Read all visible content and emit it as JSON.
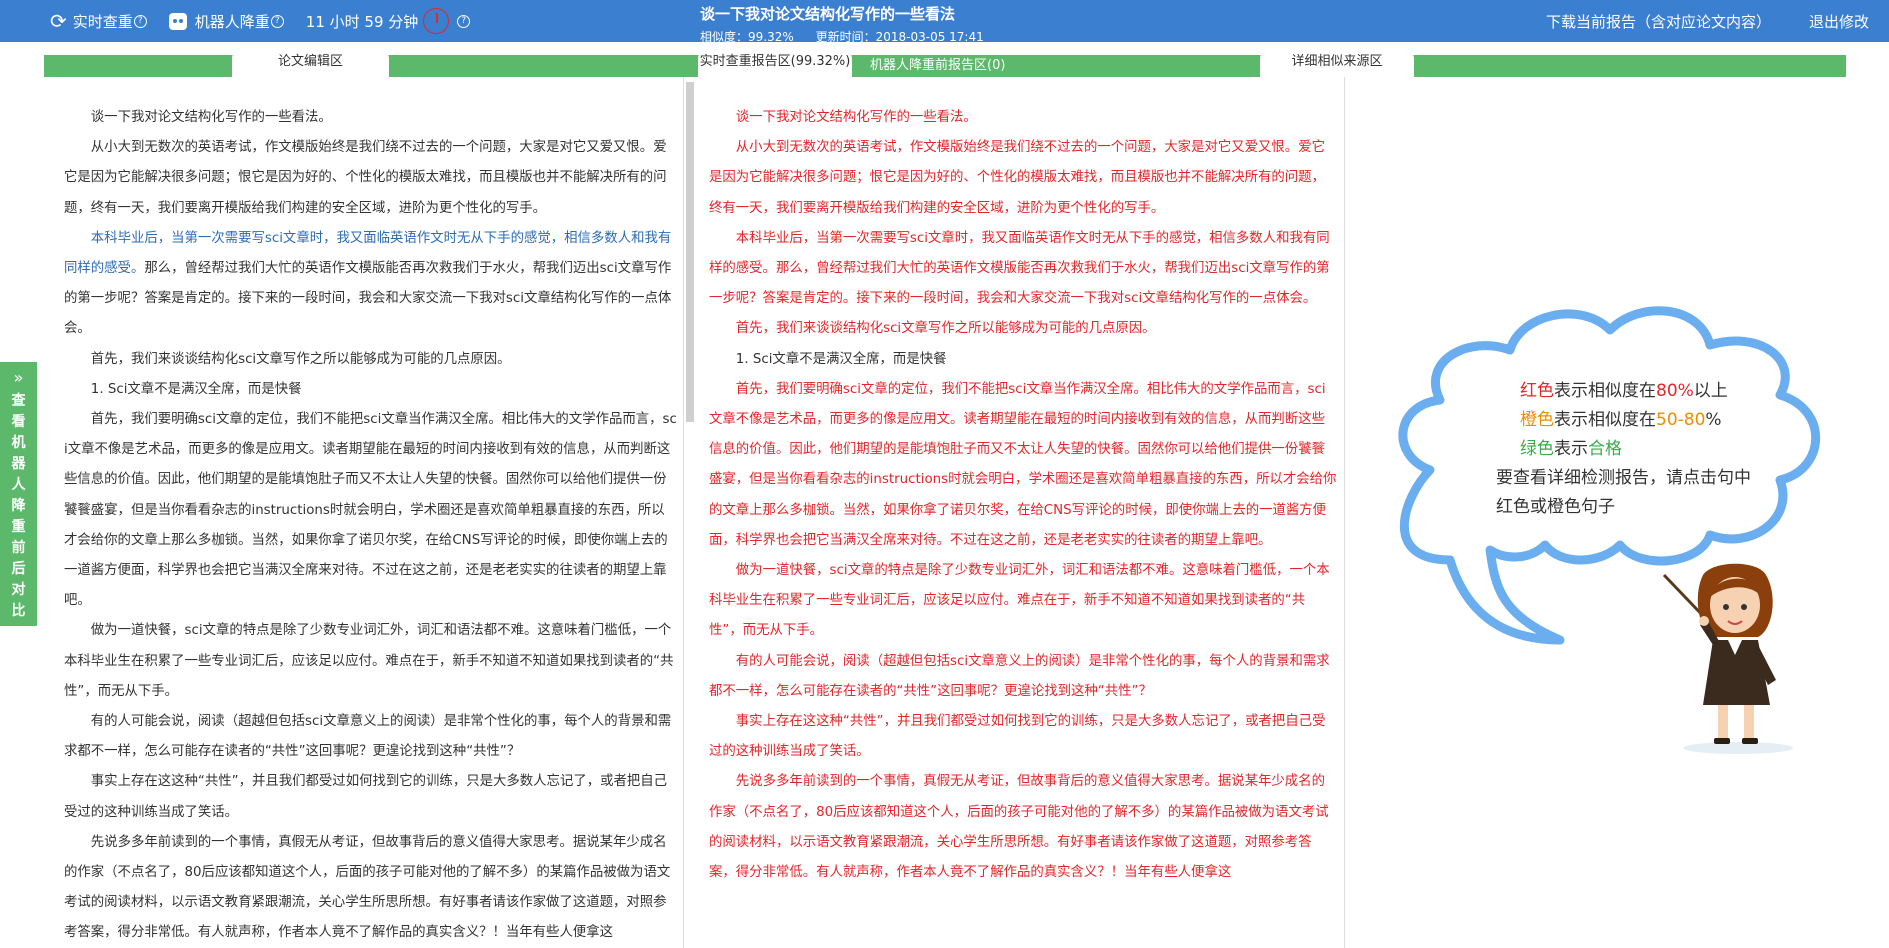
{
  "topbar": {
    "realtime_check": "实时查重",
    "robot_reduce": "机器人降重",
    "time_left": "11 小时 59 分钟",
    "help": "?",
    "title": "谈一下我对论文结构化写作的一些看法",
    "similarity": "相似度：99.32%",
    "updated": "更新时间：2018-03-05 17:41",
    "download": "下载当前报告（含对应论文内容）",
    "exit": "退出修改"
  },
  "tabs": {
    "editor": "论文编辑区",
    "report": "实时查重报告区(99.32%)",
    "robot_report": "机器人降重前报告区(0)",
    "sources": "详细相似来源区"
  },
  "sidetab": {
    "arrow": "»",
    "label": "查看机器人降重前后对比"
  },
  "paragraphs": [
    "谈一下我对论文结构化写作的一些看法。",
    "从小大到无数次的英语考试，作文模版始终是我们绕不过去的一个问题，大家是对它又爱又恨。爱它是因为它能解决很多问题；恨它是因为好的、个性化的模版太难找，而且模版也并不能解决所有的问题，终有一天，我们要离开模版给我们构建的安全区域，进阶为更个性化的写手。",
    "本科毕业后，当第一次需要写sci文章时，我又面临英语作文时无从下手的感觉，相信多数人和我有同样的感受。",
    "那么，曾经帮过我们大忙的英语作文模版能否再次救我们于水火，帮我们迈出sci文章写作的第一步呢？答案是肯定的。接下来的一段时间，我会和大家交流一下我对sci文章结构化写作的一点体会。",
    "首先，我们来谈谈结构化sci文章写作之所以能够成为可能的几点原因。",
    "1. Sci文章不是满汉全席，而是快餐",
    "首先，我们要明确sci文章的定位，我们不能把sci文章当作满汉全席。相比伟大的文学作品而言，sci文章不像是艺术品，而更多的像是应用文。读者期望能在最短的时间内接收到有效的信息，从而判断这些信息的价值。因此，他们期望的是能填饱肚子而又不太让人失望的快餐。固然你可以给他们提供一份饕餮盛宴，但是当你看看杂志的instructions时就会明白，学术圈还是喜欢简单粗暴直接的东西，所以才会给你的文章上那么多枷锁。当然，如果你拿了诺贝尔奖，在给CNS写评论的时候，即使你端上去的一道酱方便面，科学界也会把它当满汉全席来对待。不过在这之前，还是老老实实的往读者的期望上靠吧。",
    "做为一道快餐，sci文章的特点是除了少数专业词汇外，词汇和语法都不难。这意味着门槛低，一个本科毕业生在积累了一些专业词汇后，应该足以应付。难点在于，新手不知道不知道如果找到读者的“共性”，而无从下手。",
    "有的人可能会说，阅读（超越但包括sci文章意义上的阅读）是非常个性化的事，每个人的背景和需求都不一样，怎么可能存在读者的“共性”这回事呢？更遑论找到这种“共性”？",
    "事实上存在这这种“共性”，并且我们都受过如何找到它的训练，只是大多数人忘记了，或者把自己受过的这种训练当成了笑话。",
    "先说多多年前读到的一个事情，真假无从考证，但故事背后的意义值得大家思考。据说某年少成名的作家（不点名了，80后应该都知道这个人，后面的孩子可能对他的了解不多）的某篇作品被做为语文考试的阅读材料，以示语文教育紧跟潮流，关心学生所思所想。有好事者请该作家做了这道题，对照参考答案，得分非常低。有人就声称，作者本人竟不了解作品的真实含义？！当年有些人便拿这"
  ],
  "legend": {
    "red_word": "红色",
    "red_text": "表示相似度在",
    "red_value": "80%",
    "red_suffix": "以上",
    "orange_word": "橙色",
    "orange_text": "表示相似度在",
    "orange_value": "50-80",
    "orange_suffix": "%",
    "green_word": "绿色",
    "green_text": "表示",
    "green_value": "合格",
    "hint1": "要查看详细检测报告，请点击句中",
    "hint2": "红色或橙色句子"
  },
  "colors": {
    "topbar": "#3a7fd0",
    "tabbar": "#5cb96b",
    "red": "#e2262a",
    "orange": "#f08c00",
    "green": "#3aab4a",
    "highlight_blue": "#2e6bb5"
  }
}
